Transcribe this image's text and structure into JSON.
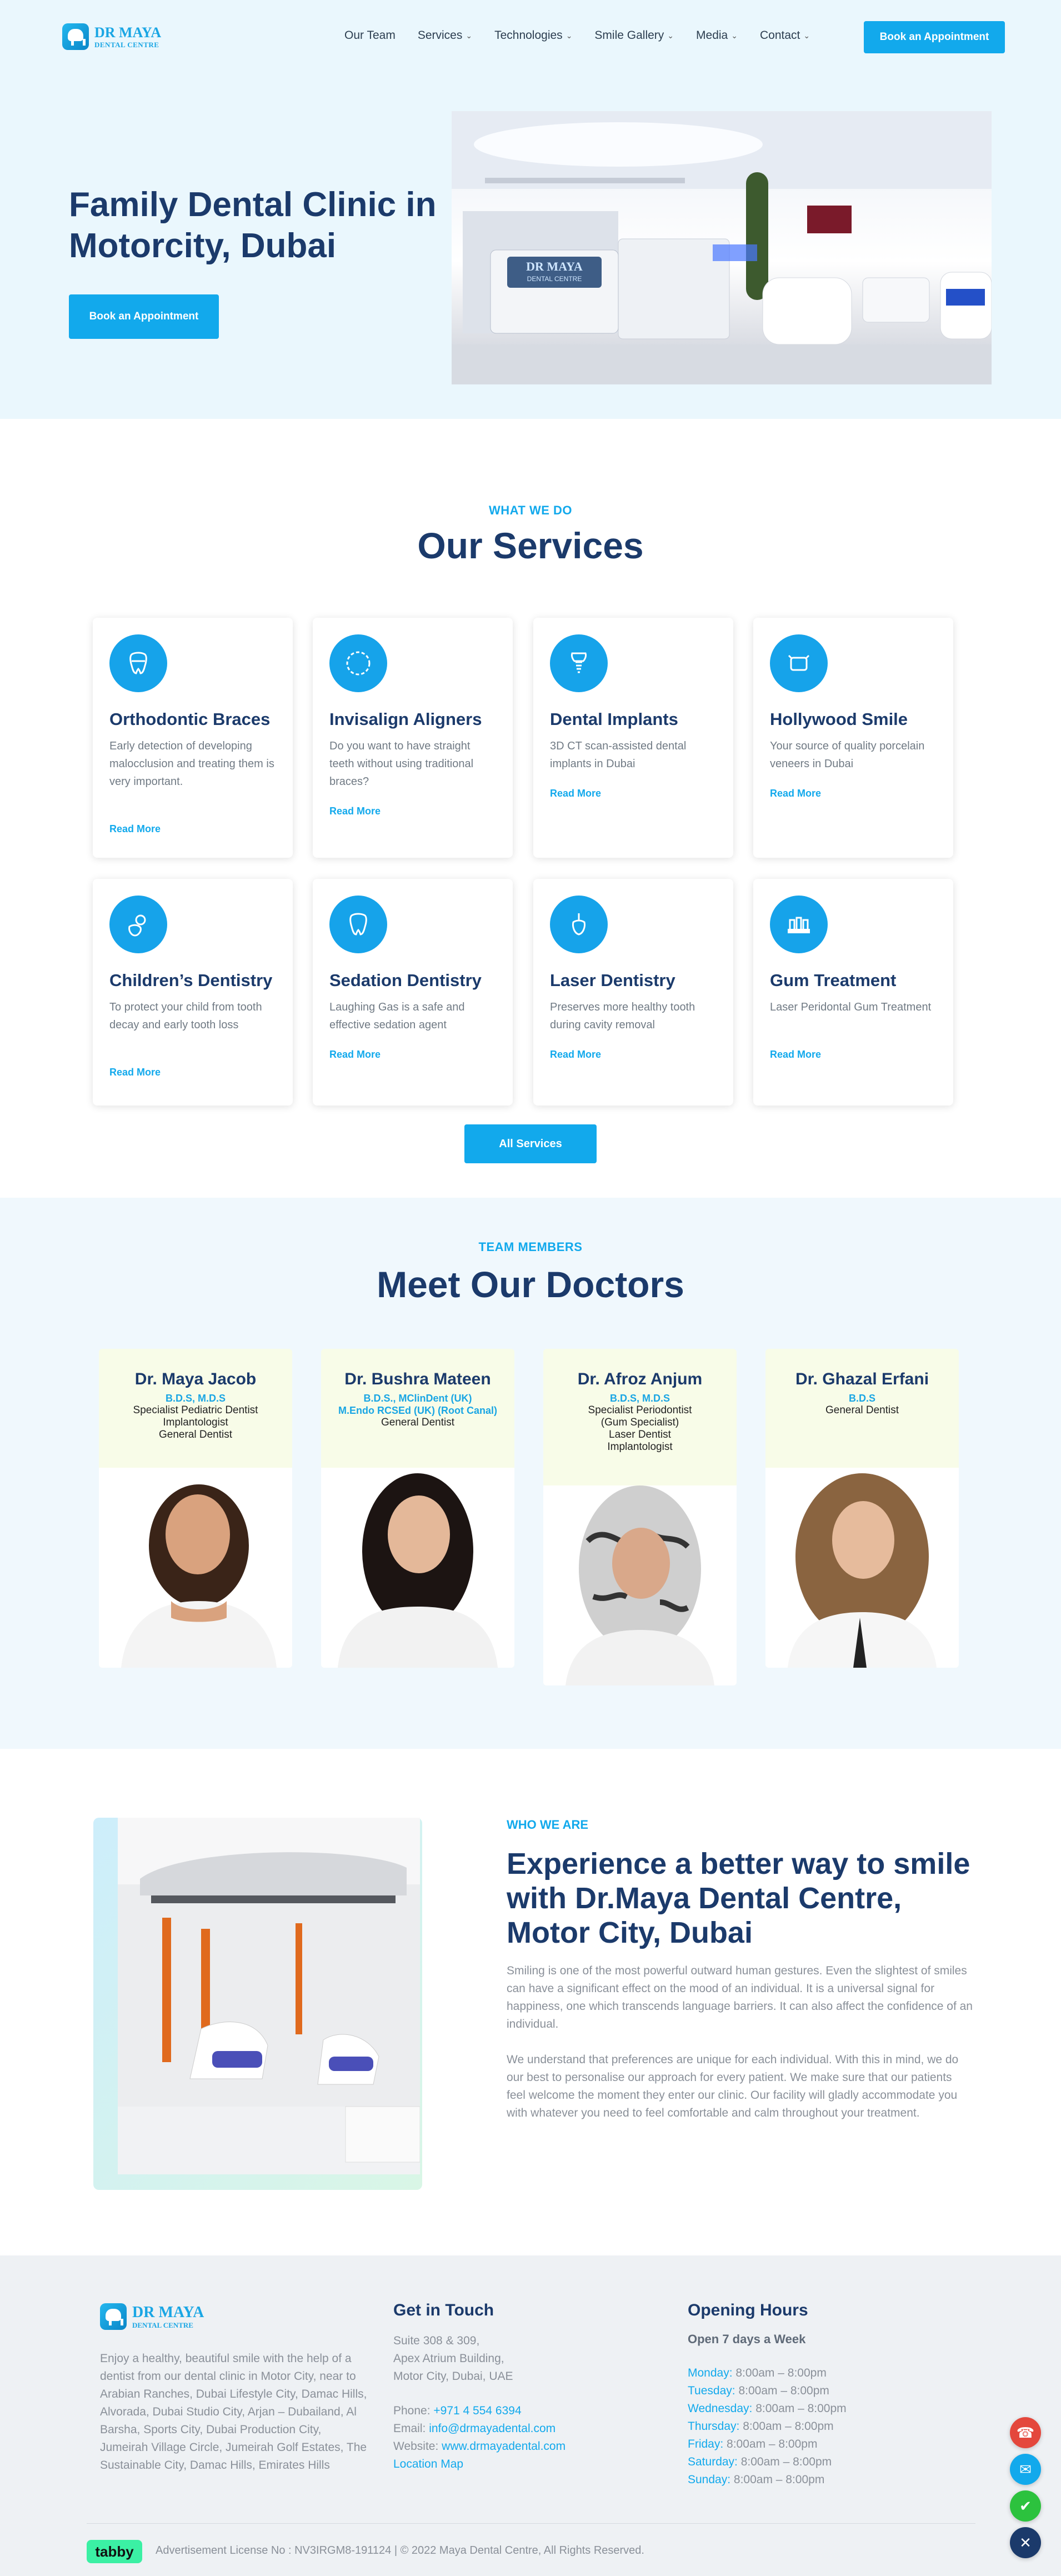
{
  "header": {
    "logo_line1": "DR MAYA",
    "logo_line2": "DENTAL CENTRE",
    "nav": [
      {
        "label": "Our Team",
        "dropdown": false
      },
      {
        "label": "Services",
        "dropdown": true
      },
      {
        "label": "Technologies",
        "dropdown": true
      },
      {
        "label": "Smile Gallery",
        "dropdown": true
      },
      {
        "label": "Media",
        "dropdown": true
      },
      {
        "label": "Contact",
        "dropdown": true
      }
    ],
    "cta": "Book an Appointment"
  },
  "hero": {
    "title": "Family Dental Clinic in Motorcity, Dubai",
    "cta": "Book an Appointment",
    "sign_line1": "DR MAYA",
    "sign_line2": "DENTAL CENTRE"
  },
  "services": {
    "eyebrow": "WHAT WE DO",
    "title": "Our Services",
    "items": [
      {
        "title": "Orthodontic Braces",
        "desc": "Early detection of developing malocclusion and treating them is very important.",
        "more": "Read More",
        "icon": "braces-icon"
      },
      {
        "title": "Invisalign Aligners",
        "desc": "Do you want to have straight teeth without using traditional braces?",
        "more": "Read More",
        "icon": "aligner-icon"
      },
      {
        "title": "Dental Implants",
        "desc": "3D CT scan-assisted dental implants in Dubai",
        "more": "Read More",
        "icon": "implant-icon"
      },
      {
        "title": "Hollywood Smile",
        "desc": "Your source of quality porcelain veneers in Dubai",
        "more": "Read More",
        "icon": "veneer-icon"
      },
      {
        "title": "Children’s Dentistry",
        "desc": "To protect your child from tooth decay and early tooth loss",
        "more": "Read More",
        "icon": "child-tooth-icon"
      },
      {
        "title": "Sedation Dentistry",
        "desc": "Laughing Gas is a safe and effective sedation agent",
        "more": "Read More",
        "icon": "sedation-icon"
      },
      {
        "title": "Laser Dentistry",
        "desc": "Preserves more healthy tooth during cavity removal",
        "more": "Read More",
        "icon": "laser-icon"
      },
      {
        "title": "Gum Treatment",
        "desc": "Laser Peridontal Gum Treatment",
        "more": "Read More",
        "icon": "gum-icon"
      }
    ],
    "all_button": "All Services"
  },
  "doctors": {
    "eyebrow": "TEAM MEMBERS",
    "title": "Meet Our Doctors",
    "items": [
      {
        "name": "Dr. Maya Jacob",
        "degrees": [
          "B.D.S, M.D.S"
        ],
        "roles": [
          "Specialist Pediatric Dentist",
          "Implantologist",
          "General Dentist"
        ]
      },
      {
        "name": "Dr. Bushra Mateen",
        "degrees": [
          "B.D.S., MClinDent (UK)",
          "M.Endo RCSEd (UK) (Root Canal)"
        ],
        "roles": [
          "General Dentist"
        ]
      },
      {
        "name": "Dr. Afroz Anjum",
        "degrees": [
          "B.D.S, M.D.S"
        ],
        "roles": [
          "Specialist Periodontist",
          "(Gum Specialist)",
          "Laser Dentist",
          "Implantologist"
        ]
      },
      {
        "name": "Dr. Ghazal Erfani",
        "degrees": [
          "B.D.S"
        ],
        "roles": [
          "General Dentist"
        ]
      }
    ]
  },
  "about": {
    "eyebrow": "WHO WE ARE",
    "title": "Experience a better way to smile with Dr.Maya Dental Centre, Motor City, Dubai",
    "p1": "Smiling is one of the most powerful outward human gestures. Even the slightest of smiles can have a significant effect on the mood of an individual. It is a universal signal for happiness, one which transcends language barriers. It can also affect the confidence of an individual.",
    "p2": "We understand that preferences are unique for each individual. With this in mind, we do our best to personalise our approach for every patient. We make sure that our patients feel welcome the moment they enter our clinic. Our facility will gladly accommodate you with whatever you need to feel comfortable and calm throughout your treatment."
  },
  "footer": {
    "logo_line1": "DR MAYA",
    "logo_line2": "DENTAL CENTRE",
    "about_text": "Enjoy a healthy, beautiful smile with the help of a dentist from our dental clinic in Motor City, near to Arabian Ranches, Dubai Lifestyle City, Damac Hills, Alvorada, Dubai Studio City, Arjan – Dubailand, Al Barsha, Sports City, Dubai Production City, Jumeirah Village Circle, Jumeirah Golf Estates, The Sustainable City, Damac Hills, Emirates Hills",
    "touch_title": "Get in Touch",
    "address": [
      "Suite 308 & 309,",
      "Apex Atrium Building,",
      "Motor City, Dubai, UAE"
    ],
    "phone_label": "Phone: ",
    "phone": "+971 4 554 6394",
    "email_label": "Email: ",
    "email": "info@drmayadental.com",
    "website_label": "Website: ",
    "website": "www.drmayadental.com",
    "map": "Location Map",
    "hours_title": "Opening Hours",
    "hours_sub": "Open 7 days a Week",
    "hours": [
      {
        "day": "Monday:",
        "time": " 8:00am – 8:00pm"
      },
      {
        "day": "Tuesday:",
        "time": " 8:00am – 8:00pm"
      },
      {
        "day": "Wednesday:",
        "time": " 8:00am – 8:00pm"
      },
      {
        "day": "Thursday:",
        "time": " 8:00am – 8:00pm"
      },
      {
        "day": "Friday:",
        "time": " 8:00am – 8:00pm"
      },
      {
        "day": "Saturday:",
        "time": " 8:00am – 8:00pm"
      },
      {
        "day": "Sunday:",
        "time": " 8:00am – 8:00pm"
      }
    ],
    "tabby": "tabby",
    "license": "Advertisement License No : NV3IRGM8-191124 | © 2022 Maya Dental Centre, All Rights Reserved."
  },
  "colors": {
    "accent": "#12a9ec",
    "navy": "#1b3a6b",
    "hero_bg": "#eaf7fd",
    "doc_card": "#f8fce8",
    "phone": "#e4473c",
    "whatsapp": "#2cc23e",
    "close": "#1b3a6b"
  }
}
